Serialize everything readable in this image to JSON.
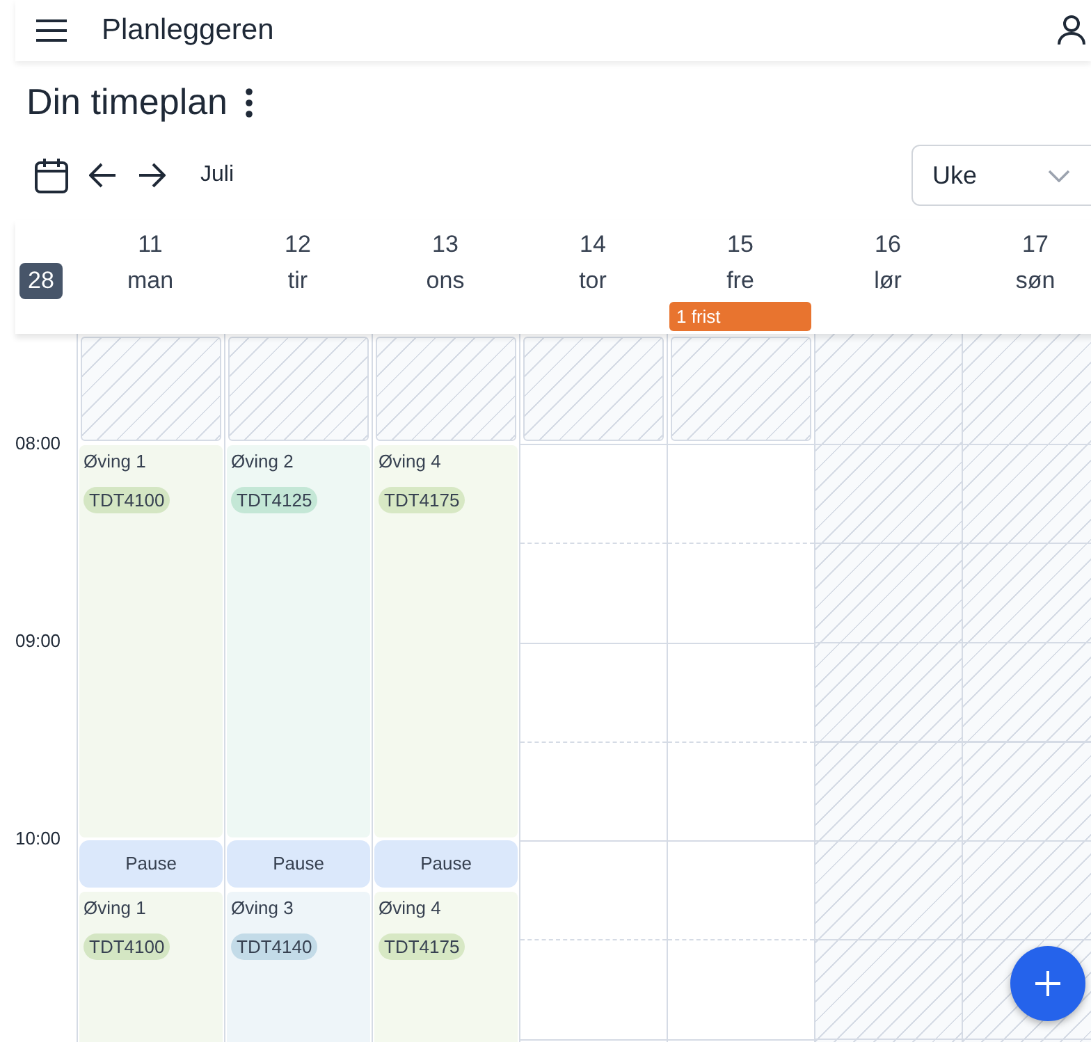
{
  "app_bar": {
    "title": "Planleggeren"
  },
  "page": {
    "title": "Din timeplan"
  },
  "toolbar": {
    "month": "Juli",
    "view_select": {
      "value": "Uke"
    }
  },
  "week_number": "28",
  "time_labels": [
    "08:00",
    "09:00",
    "10:00"
  ],
  "days": [
    {
      "date": "11",
      "weekday": "man",
      "weekend": false,
      "events": [
        {
          "kind": "task",
          "title": "Øving 1",
          "course": "TDT4100",
          "color": "#d4e6c3"
        },
        {
          "kind": "break",
          "title": "Pause"
        },
        {
          "kind": "task",
          "title": "Øving 1",
          "course": "TDT4100",
          "color": "#d4e6c3"
        }
      ]
    },
    {
      "date": "12",
      "weekday": "tir",
      "weekend": false,
      "events": [
        {
          "kind": "task",
          "title": "Øving 2",
          "course": "TDT4125",
          "color": "#c4e7d6"
        },
        {
          "kind": "break",
          "title": "Pause"
        },
        {
          "kind": "task",
          "title": "Øving 3",
          "course": "TDT4140",
          "color": "#c3dbe8"
        }
      ]
    },
    {
      "date": "13",
      "weekday": "ons",
      "weekend": false,
      "events": [
        {
          "kind": "task",
          "title": "Øving 4",
          "course": "TDT4175",
          "color": "#d7e8c4"
        },
        {
          "kind": "break",
          "title": "Pause"
        },
        {
          "kind": "task",
          "title": "Øving 4",
          "course": "TDT4175",
          "color": "#d7e8c4"
        }
      ]
    },
    {
      "date": "14",
      "weekday": "tor",
      "weekend": false
    },
    {
      "date": "15",
      "weekday": "fre",
      "weekend": false,
      "deadline": "1 frist"
    },
    {
      "date": "16",
      "weekday": "lør",
      "weekend": true
    },
    {
      "date": "17",
      "weekday": "søn",
      "weekend": true
    }
  ]
}
